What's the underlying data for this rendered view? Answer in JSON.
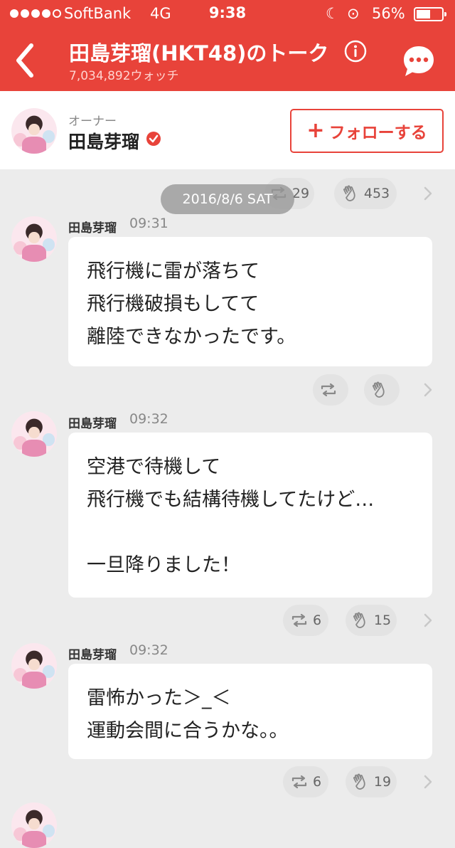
{
  "status_bar": {
    "carrier": "SoftBank",
    "network": "4G",
    "time": "9:38",
    "battery": "56%",
    "battery_level": 0.56
  },
  "header": {
    "title": "田島芽瑠(HKT48)のトーク",
    "watch_count": "7,034,892ウォッチ"
  },
  "owner": {
    "label": "オーナー",
    "name": "田島芽瑠",
    "follow_label": "フォローする"
  },
  "date_divider": "2016/8/6 SAT",
  "top_reactions": {
    "repost_count": "29",
    "clap_count": "453"
  },
  "messages": [
    {
      "name": "田島芽瑠",
      "time": "09:31",
      "lines": [
        "飛行機に雷が落ちて",
        "飛行機破損もしてて",
        "離陸できなかったです。"
      ],
      "repost_count": "",
      "clap_count": ""
    },
    {
      "name": "田島芽瑠",
      "time": "09:32",
      "lines": [
        "空港で待機して",
        "飛行機でも結構待機してたけど…",
        "",
        "一旦降りました！"
      ],
      "repost_count": "6",
      "clap_count": "15"
    },
    {
      "name": "田島芽瑠",
      "time": "09:32",
      "lines": [
        "雷怖かった＞_＜",
        "運動会間に合うかな。。"
      ],
      "repost_count": "6",
      "clap_count": "19"
    }
  ],
  "colors": {
    "brand": "#e8433a",
    "background": "#ececec",
    "bubble": "#ffffff"
  },
  "icons": [
    "back-icon",
    "info-icon",
    "chat-menu-icon",
    "verified-icon",
    "repost-icon",
    "clap-icon",
    "chevron-right-icon"
  ]
}
